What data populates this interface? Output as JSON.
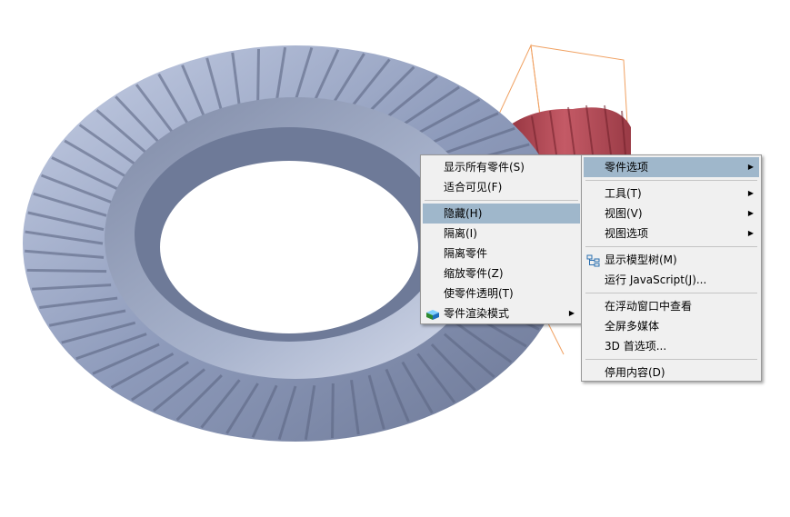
{
  "context_menu": {
    "items": [
      {
        "label": "显示所有零件(S)"
      },
      {
        "label": "适合可见(F)"
      },
      {
        "separator": true
      },
      {
        "label": "隐藏(H)",
        "highlighted": true
      },
      {
        "label": "隔离(I)"
      },
      {
        "label": "隔离零件"
      },
      {
        "label": "缩放零件(Z)"
      },
      {
        "label": "使零件透明(T)"
      },
      {
        "label": "零件渲染模式",
        "icon": "render-mode-cube-icon",
        "submenu": true
      }
    ]
  },
  "submenu": {
    "items": [
      {
        "label": "零件选项",
        "highlighted": true,
        "submenu": true
      },
      {
        "separator": true
      },
      {
        "label": "工具(T)",
        "submenu": true
      },
      {
        "label": "视图(V)",
        "submenu": true
      },
      {
        "label": "视图选项",
        "submenu": true
      },
      {
        "separator": true
      },
      {
        "label": "显示模型树(M)",
        "icon": "model-tree-icon"
      },
      {
        "label": "运行 JavaScript(J)..."
      },
      {
        "separator": true
      },
      {
        "label": "在浮动窗口中查看"
      },
      {
        "label": "全屏多媒体"
      },
      {
        "label": "3D 首选项..."
      },
      {
        "separator": true
      },
      {
        "label": "停用内容(D)"
      }
    ]
  },
  "colors": {
    "menu_bg": "#f0f0f0",
    "highlight": "#9fb7cb",
    "gear_main": "#9aa6c3",
    "gear_pinion": "#b8525e",
    "bounding_box": "#f0a060"
  }
}
